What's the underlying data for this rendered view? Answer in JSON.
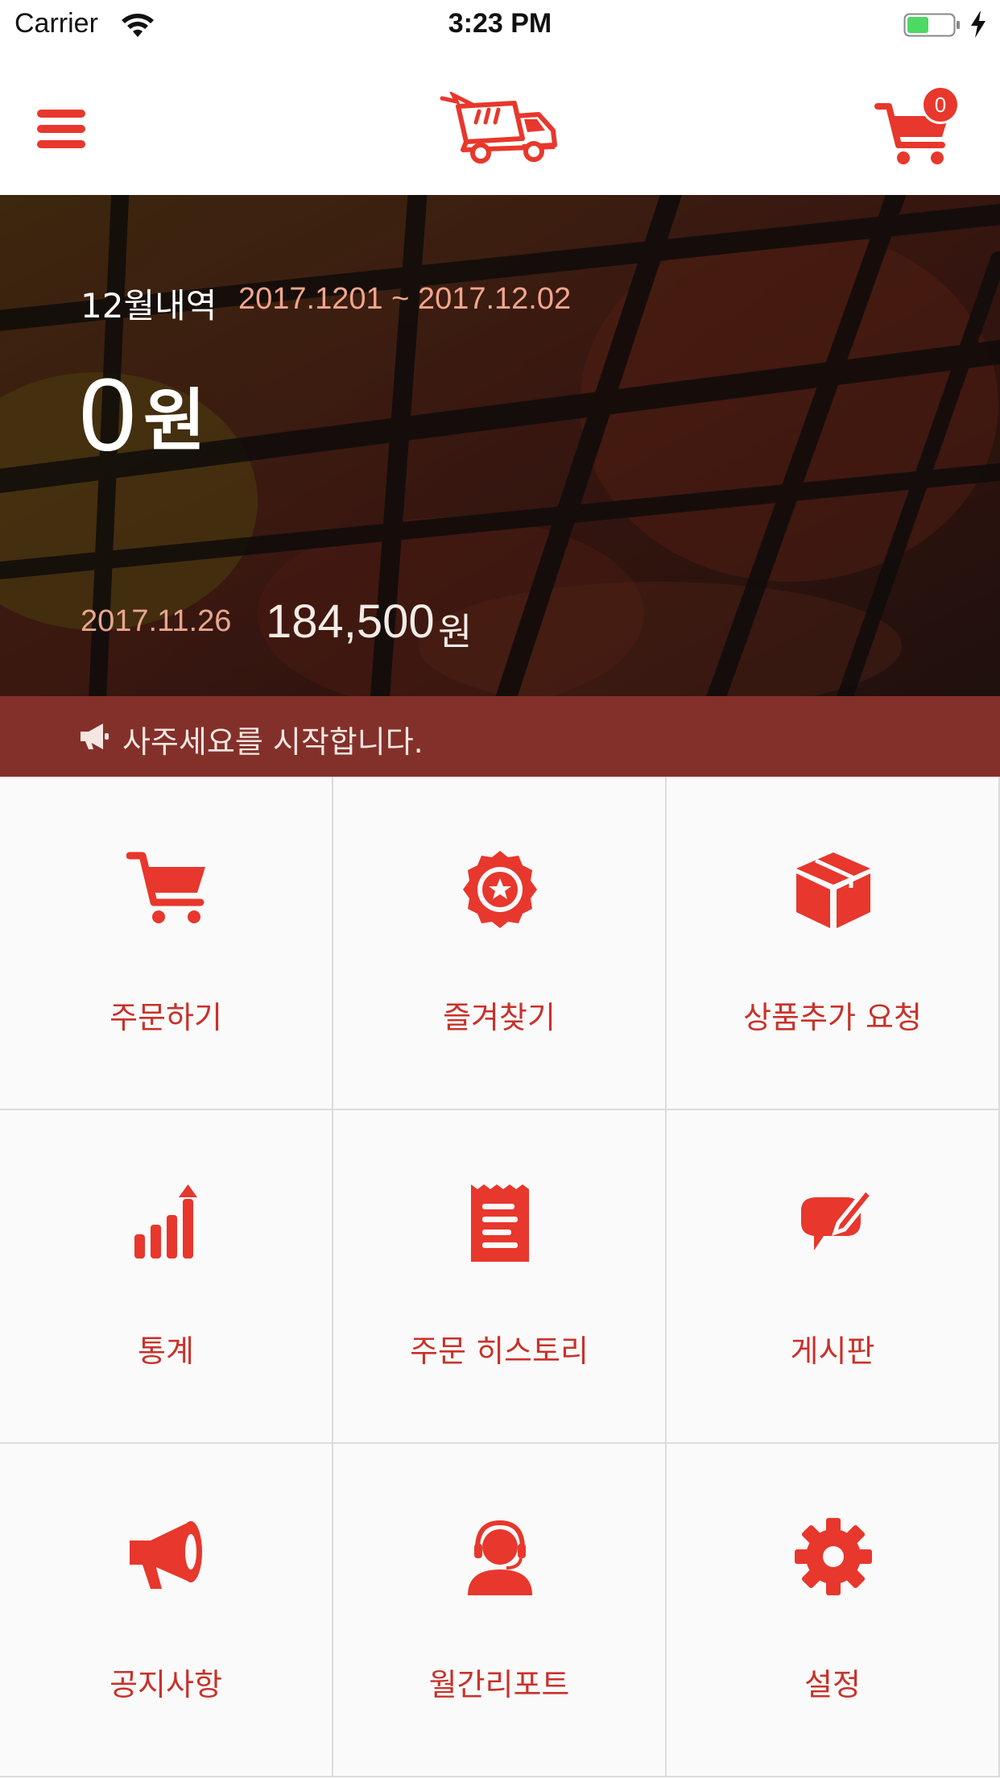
{
  "status_bar": {
    "carrier": "Carrier",
    "time": "3:23 PM"
  },
  "header": {
    "cart_count": "0"
  },
  "hero": {
    "month_label": "12월내역",
    "date_range": "2017.1201 ~ 2017.12.02",
    "amount": "0",
    "amount_unit": "원",
    "prev_date": "2017.11.26",
    "prev_amount": "184,500",
    "prev_unit": "원"
  },
  "notice": {
    "text": "사주세요를 시작합니다."
  },
  "menu": [
    {
      "label": "주문하기",
      "icon": "cart-icon"
    },
    {
      "label": "즐겨찾기",
      "icon": "star-badge-icon"
    },
    {
      "label": "상품추가 요청",
      "icon": "box-icon"
    },
    {
      "label": "통계",
      "icon": "stats-icon"
    },
    {
      "label": "주문 히스토리",
      "icon": "receipt-icon"
    },
    {
      "label": "게시판",
      "icon": "board-icon"
    },
    {
      "label": "공지사항",
      "icon": "megaphone-icon"
    },
    {
      "label": "월간리포트",
      "icon": "support-icon"
    },
    {
      "label": "설정",
      "icon": "gear-icon"
    }
  ],
  "colors": {
    "accent": "#e8372c",
    "notice_bg": "#83302a",
    "label": "#c8322a"
  }
}
